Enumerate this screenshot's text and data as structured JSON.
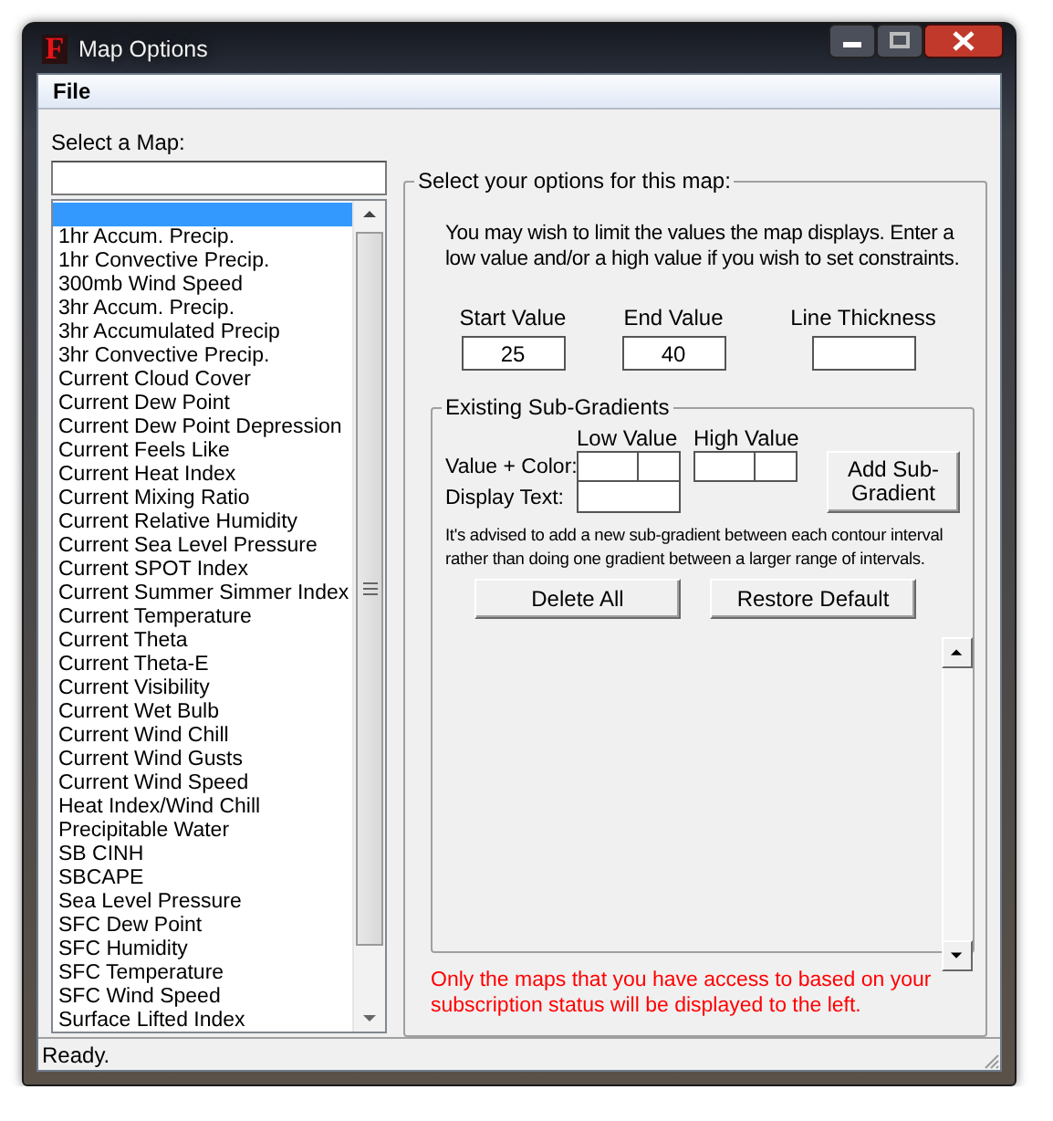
{
  "window": {
    "icon_text": "F",
    "title": "Map Options"
  },
  "menu": [
    "File"
  ],
  "map_list": {
    "label": "Select a Map:",
    "items": [
      {
        "selected": true
      },
      {
        "label": "1hr Accum. Precip.",
        "selected": false
      },
      {
        "label": "1hr Convective Precip.",
        "selected": false
      },
      {
        "label": "300mb Wind Speed",
        "selected": false
      },
      {
        "label": "3hr Accum. Precip.",
        "selected": false
      },
      {
        "label": "3hr Accumulated Precip",
        "selected": false
      },
      {
        "label": "3hr Convective Precip.",
        "selected": false
      },
      {
        "label": "Current Cloud Cover",
        "selected": false
      },
      {
        "label": "Current Dew Point",
        "selected": false
      },
      {
        "label": "Current Dew Point Depression",
        "selected": false
      },
      {
        "label": "Current Feels Like",
        "selected": false
      },
      {
        "label": "Current Heat Index",
        "selected": false
      },
      {
        "label": "Current Mixing Ratio",
        "selected": false
      },
      {
        "label": "Current Relative Humidity",
        "selected": false
      },
      {
        "label": "Current Sea Level Pressure",
        "selected": false
      },
      {
        "label": "Current SPOT Index",
        "selected": false
      },
      {
        "label": "Current Summer Simmer Index",
        "selected": false
      },
      {
        "label": "Current Temperature",
        "selected": false
      },
      {
        "label": "Current Theta",
        "selected": false
      },
      {
        "label": "Current Theta-E",
        "selected": false
      },
      {
        "label": "Current Visibility",
        "selected": false
      },
      {
        "label": "Current Wet Bulb",
        "selected": false
      },
      {
        "label": "Current Wind Chill",
        "selected": false
      },
      {
        "label": "Current Wind Gusts",
        "selected": false
      },
      {
        "label": "Current Wind Speed",
        "selected": false
      },
      {
        "label": "Heat Index/Wind Chill",
        "selected": false
      },
      {
        "label": "Precipitable Water",
        "selected": false
      },
      {
        "label": "SB CINH",
        "selected": false
      },
      {
        "label": "SBCAPE",
        "selected": false
      },
      {
        "label": "Sea Level Pressure",
        "selected": false
      },
      {
        "label": "SFC Dew Point",
        "selected": false
      },
      {
        "label": "SFC Humidity",
        "selected": false
      },
      {
        "label": "SFC Temperature",
        "selected": false
      },
      {
        "label": "SFC Wind Speed",
        "selected": false
      },
      {
        "label": "Surface Lifted Index",
        "selected": false
      }
    ]
  },
  "options": {
    "legend": "Select your options for this map:",
    "intro": "You may wish to limit the values the map displays. Enter a low value and/or a high value if you wish to set constraints.",
    "fields": [
      {
        "label": "Start Value",
        "value": "25"
      },
      {
        "label": "End Value",
        "value": "40"
      },
      {
        "label": "Line Thickness"
      }
    ],
    "sub_gradients": {
      "legend": "Existing Sub-Gradients",
      "low_value_label": "Low Value",
      "high_value_label": "High Value",
      "value_color_label": "Value + Color:",
      "display_text_label": "Display Text:",
      "add_button": "Add Sub-Gradient",
      "note": "It's advised to add a new sub-gradient between each contour interval rather than doing one gradient between a larger range of intervals.",
      "buttons": [
        "Delete All",
        "Restore Default"
      ]
    },
    "notice": "Only the maps that you have access to based on your subscription status will be displayed to the left."
  },
  "status_bar": "Ready."
}
